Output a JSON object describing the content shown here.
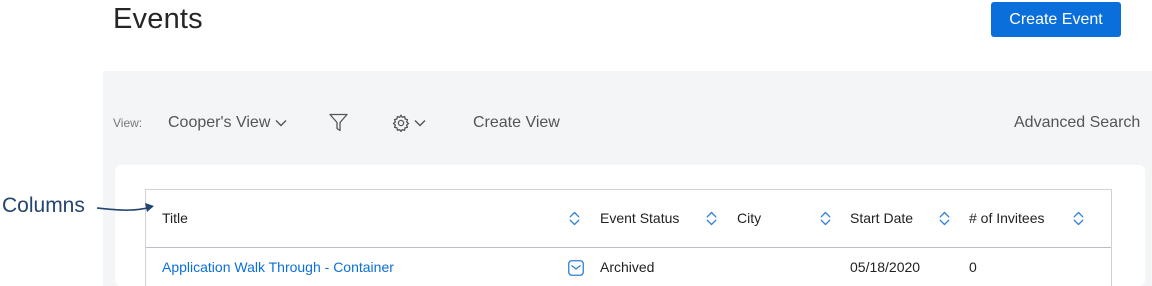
{
  "header": {
    "title": "Events",
    "create_button": "Create Event"
  },
  "toolbar": {
    "view_label": "View:",
    "current_view": "Cooper's View",
    "create_view": "Create View",
    "advanced_search": "Advanced Search",
    "icons": [
      "chevron-down-icon",
      "filter-icon",
      "gear-icon"
    ]
  },
  "table": {
    "columns": [
      "Title",
      "Event Status",
      "City",
      "Start Date",
      "# of Invitees"
    ],
    "rows": [
      {
        "title": "Application Walk Through - Container",
        "status": "Archived",
        "city": "",
        "start_date": "05/18/2020",
        "invitees": "0"
      }
    ]
  },
  "annotation": {
    "label": "Columns"
  },
  "colors": {
    "accent": "#0b6fdb",
    "panel_bg": "#f4f5f7",
    "annotation": "#23446e"
  }
}
